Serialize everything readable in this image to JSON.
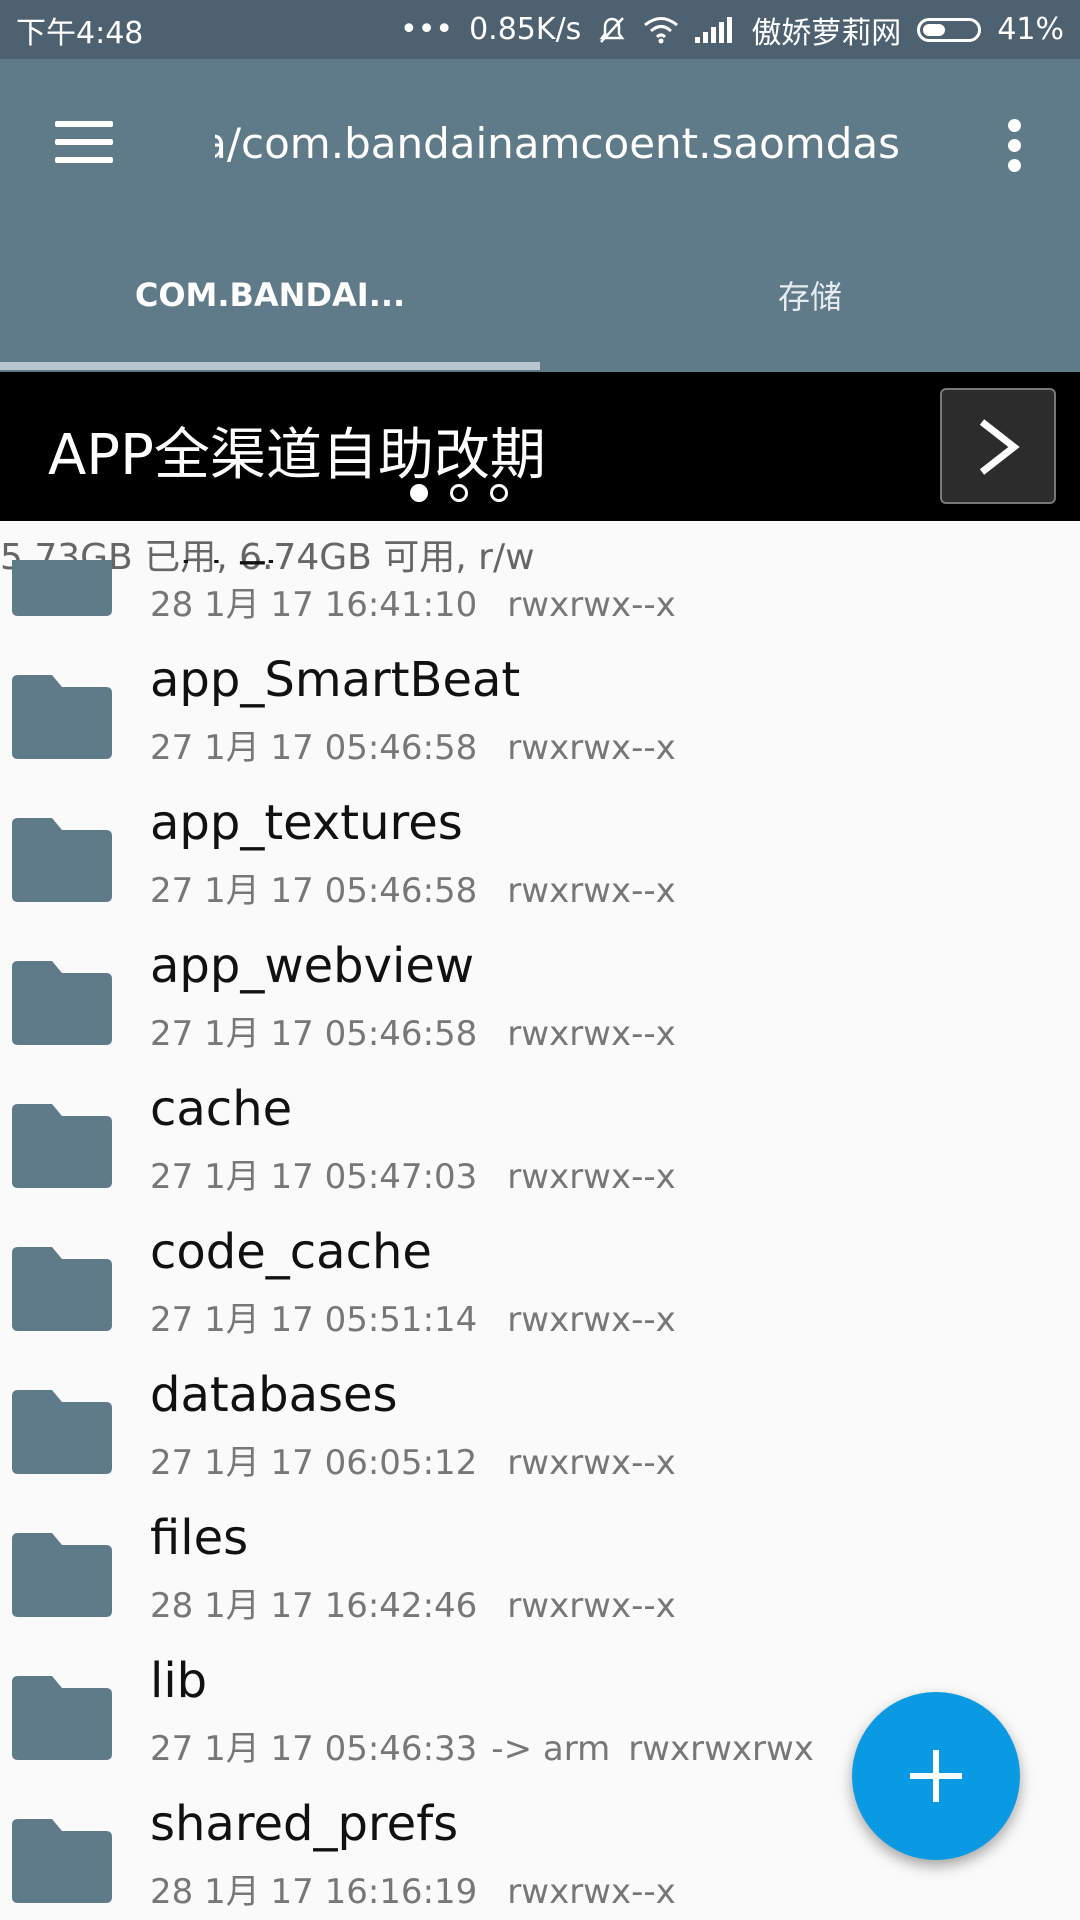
{
  "status_bar": {
    "time": "下午4:48",
    "network_speed": "0.85K/s",
    "carrier": "傲娇萝莉网",
    "battery_percent": "41%",
    "battery_level": 0.41
  },
  "app_bar": {
    "path": "/data/data/com.bandainamcoent.saomdas"
  },
  "tabs": [
    {
      "label": "COM.BANDAI...",
      "active": true
    },
    {
      "label": "存储",
      "active": false
    }
  ],
  "banner": {
    "text": "APP全渠道自助改期",
    "dots_total": 3,
    "active_dot": 0
  },
  "storage_info": "5.73GB 已用, 6.74GB 可用, r/w",
  "files": [
    {
      "name": "app_partial",
      "date": "28 1月 17 16:41:10",
      "extra": "",
      "perm": "rwxrwx--x"
    },
    {
      "name": "app_SmartBeat",
      "date": "27 1月 17 05:46:58",
      "extra": "",
      "perm": "rwxrwx--x"
    },
    {
      "name": "app_textures",
      "date": "27 1月 17 05:46:58",
      "extra": "",
      "perm": "rwxrwx--x"
    },
    {
      "name": "app_webview",
      "date": "27 1月 17 05:46:58",
      "extra": "",
      "perm": "rwxrwx--x"
    },
    {
      "name": "cache",
      "date": "27 1月 17 05:47:03",
      "extra": "",
      "perm": "rwxrwx--x"
    },
    {
      "name": "code_cache",
      "date": "27 1月 17 05:51:14",
      "extra": "",
      "perm": "rwxrwx--x"
    },
    {
      "name": "databases",
      "date": "27 1月 17 06:05:12",
      "extra": "",
      "perm": "rwxrwx--x"
    },
    {
      "name": "files",
      "date": "28 1月 17 16:42:46",
      "extra": "",
      "perm": "rwxrwx--x"
    },
    {
      "name": "lib",
      "date": "27 1月 17 05:46:33",
      "extra": "-> arm",
      "perm": "rwxrwxrwx"
    },
    {
      "name": "shared_prefs",
      "date": "28 1月 17 16:16:19",
      "extra": "",
      "perm": "rwxrwx--x"
    }
  ],
  "colors": {
    "status_bar": "#4d6170",
    "app_bar": "#5f7a89",
    "folder_icon": "#5f7a89",
    "fab": "#0a9ae3"
  },
  "fab_icon": "plus-icon"
}
